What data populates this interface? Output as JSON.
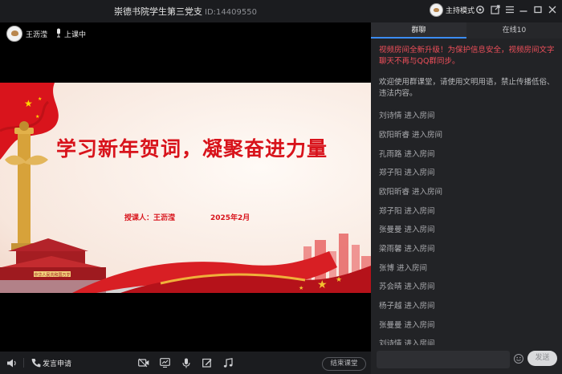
{
  "window": {
    "title": "崇德书院学生第三党支",
    "room_id": "ID:14409550",
    "host_mode_label": "主持模式",
    "icons": [
      "host-avatar",
      "settings-icon",
      "popout-icon",
      "menu-icon",
      "minimize-icon",
      "maximize-icon",
      "close-icon"
    ]
  },
  "presenter": {
    "name": "王沥滢",
    "status": "上课中"
  },
  "slide": {
    "title": "学习新年贺词，凝聚奋进力量",
    "lecturer": "授课人：王沥滢",
    "date": "2025年2月",
    "gate_plaque": "中华人民共和国万岁"
  },
  "toolbar": {
    "speak_request": "发言申请",
    "end_class": "结束课堂",
    "icons": [
      "speaker-icon",
      "phone-icon",
      "camera-icon",
      "screen-share-icon",
      "microphone-icon",
      "whiteboard-icon",
      "music-icon"
    ]
  },
  "panel": {
    "tabs": [
      {
        "label": "群聊",
        "active": true
      },
      {
        "label": "在线10",
        "active": false
      }
    ],
    "notice_upgrade": "视频房间全新升级！为保护信息安全，视频房间文字聊天不再与QQ群同步。",
    "notice_welcome": "欢迎使用群课堂，请使用文明用语，禁止传播低俗、违法内容。",
    "joins": [
      "刘诗情 进入房间",
      "欧阳昕睿 进入房间",
      "孔雨路 进入房间",
      "郑子阳 进入房间",
      "欧阳昕睿 进入房间",
      "郑子阳 进入房间",
      "张曼曼 进入房间",
      "梁雨馨 进入房间",
      "张博 进入房间",
      "苏会晴 进入房间",
      "杨子越 进入房间",
      "张曼曼 进入房间",
      "刘诗情 进入房间"
    ],
    "input_placeholder": "",
    "send_label": "发送"
  },
  "colors": {
    "accent_red": "#d8131b",
    "notice_red": "#ef4f5a",
    "tab_underline": "#3b8cf2",
    "panel_bg": "#222326"
  }
}
